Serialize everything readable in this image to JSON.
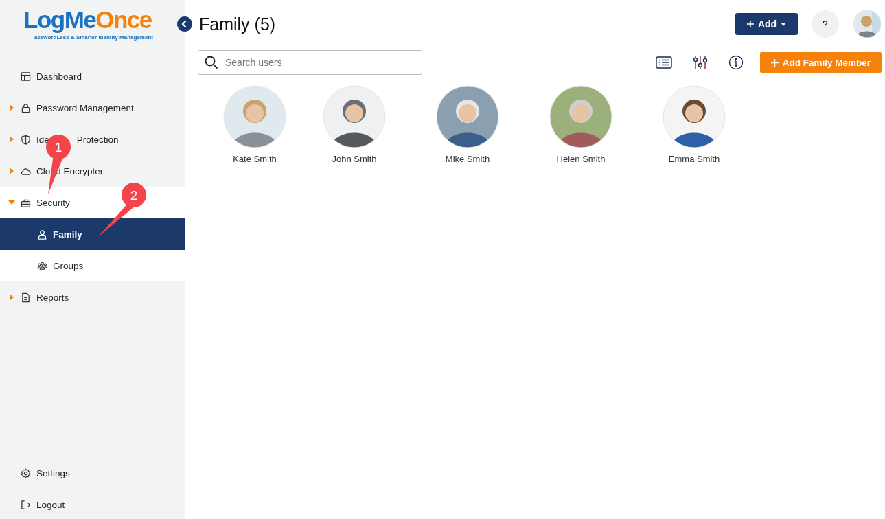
{
  "logo": {
    "name_a": "LogMe",
    "name_b": "Once",
    "tagline": "asswordLess & Smarter Identity Management"
  },
  "sidebar": {
    "items": [
      {
        "label": "Dashboard"
      },
      {
        "label": "Password Management",
        "expandable": true,
        "expanded": false
      },
      {
        "label_parts": [
          "Ide",
          "Protection"
        ],
        "expandable": true,
        "expanded": false
      },
      {
        "label_parts": [
          "Clo",
          "d Encrypter"
        ],
        "expandable": true,
        "expanded": false
      },
      {
        "label": "Security",
        "expandable": true,
        "expanded": true,
        "children": [
          {
            "label": "Family",
            "selected": true
          },
          {
            "label": "Groups",
            "selected": false
          }
        ]
      },
      {
        "label": "Reports",
        "expandable": true,
        "expanded": false
      }
    ],
    "bottom_items": [
      {
        "label": "Settings"
      },
      {
        "label": "Logout"
      }
    ]
  },
  "header": {
    "title": "Family (5)",
    "add_button": "Add",
    "help_button": "?"
  },
  "toolbar": {
    "search": {
      "placeholder": "Search users"
    },
    "add_member_button": "Add Family Member"
  },
  "members": [
    {
      "name": "Kate Smith"
    },
    {
      "name": "John Smith"
    },
    {
      "name": "Mike Smith"
    },
    {
      "name": "Helen Smith"
    },
    {
      "name": "Emma Smith"
    }
  ],
  "callouts": [
    {
      "number": "1"
    },
    {
      "number": "2"
    }
  ]
}
